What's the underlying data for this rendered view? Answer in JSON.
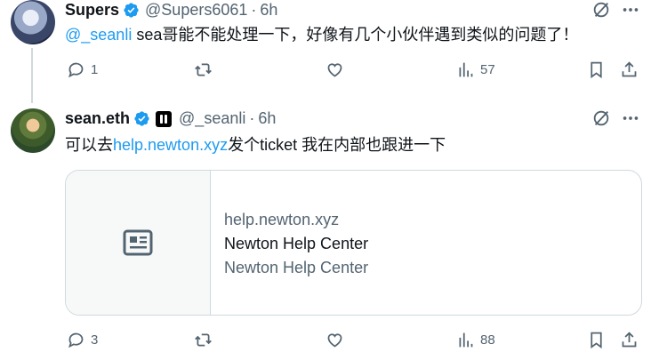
{
  "tweet1": {
    "display_name": "Supers",
    "handle": "@Supers6061",
    "time": "6h",
    "mention": "@_seanli",
    "text": " sea哥能不能处理一下，好像有几个小伙伴遇到类似的问题了！",
    "replies": "1",
    "views": "57"
  },
  "tweet2": {
    "display_name": "sean.eth",
    "handle": "@_seanli",
    "time": "6h",
    "text_prefix": "可以去",
    "link": "help.newton.xyz",
    "text_suffix": "发个ticket 我在内部也跟进一下",
    "replies": "3",
    "views": "88",
    "card": {
      "domain": "help.newton.xyz",
      "title": "Newton Help Center",
      "description": "Newton Help Center"
    }
  },
  "colors": {
    "accent": "#1d9bf0",
    "text_secondary": "#536471",
    "border": "#cfd9de"
  }
}
